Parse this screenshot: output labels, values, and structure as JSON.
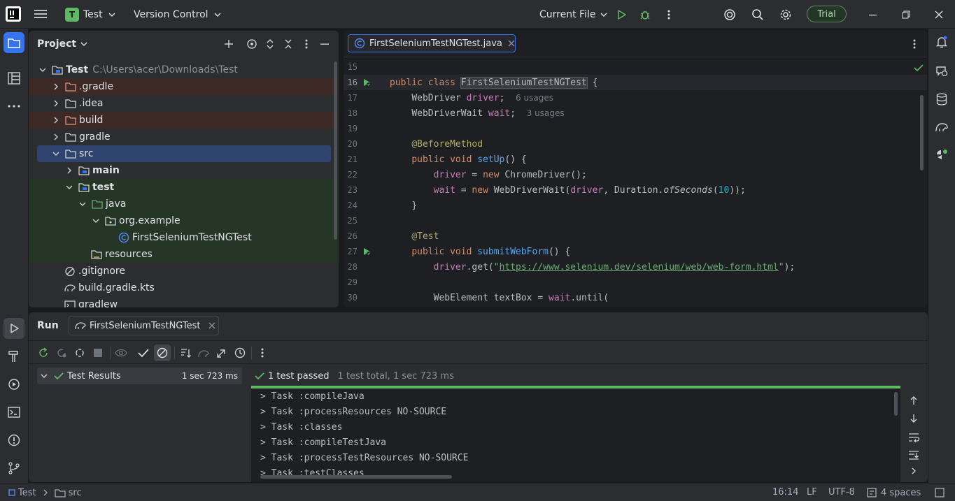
{
  "titlebar": {
    "project_badge": "T",
    "project_name": "Test",
    "vcs_label": "Version Control",
    "run_config": "Current File",
    "trial_label": "Trial"
  },
  "project_panel": {
    "title": "Project",
    "tree": [
      {
        "label": "Test",
        "path": "C:\\Users\\acer\\Downloads\\Test"
      },
      {
        "label": ".gradle"
      },
      {
        "label": ".idea"
      },
      {
        "label": "build"
      },
      {
        "label": "gradle"
      },
      {
        "label": "src"
      },
      {
        "label": "main"
      },
      {
        "label": "test"
      },
      {
        "label": "java"
      },
      {
        "label": "org.example"
      },
      {
        "label": "FirstSeleniumTestNGTest"
      },
      {
        "label": "resources"
      },
      {
        "label": ".gitignore"
      },
      {
        "label": "build.gradle.kts"
      },
      {
        "label": "gradlew"
      }
    ]
  },
  "editor": {
    "tab_label": "FirstSeleniumTestNGTest.java",
    "lines": [
      {
        "n": "15"
      },
      {
        "n": "16",
        "t": [
          "public class ",
          "FirstSeleniumTestNGTest",
          " {"
        ]
      },
      {
        "n": "17",
        "t": [
          "WebDriver ",
          "driver",
          ";",
          "6 usages"
        ]
      },
      {
        "n": "18",
        "t": [
          "WebDriverWait ",
          "wait",
          ";",
          "3 usages"
        ]
      },
      {
        "n": "19"
      },
      {
        "n": "20",
        "t": [
          "@BeforeMethod"
        ]
      },
      {
        "n": "21",
        "t": [
          "public void ",
          "setUp",
          "() {"
        ]
      },
      {
        "n": "22",
        "t": [
          "driver",
          " = ",
          "new ",
          "ChromeDriver();"
        ]
      },
      {
        "n": "23",
        "t": [
          "wait",
          " = ",
          "new ",
          "WebDriverWait(",
          "driver",
          ", Duration.",
          "ofSeconds",
          "(",
          "10",
          "));"
        ]
      },
      {
        "n": "24",
        "t": [
          "}"
        ]
      },
      {
        "n": "25"
      },
      {
        "n": "26",
        "t": [
          "@Test"
        ]
      },
      {
        "n": "27",
        "t": [
          "public void ",
          "submitWebForm",
          "() {"
        ]
      },
      {
        "n": "28",
        "t": [
          "driver",
          ".get(",
          "\"",
          "https://www.selenium.dev/selenium/web/web-form.html",
          "\"",
          ");"
        ]
      },
      {
        "n": "29"
      },
      {
        "n": "30",
        "t": [
          "WebElement textBox = ",
          "wait",
          ".until("
        ]
      }
    ]
  },
  "run_panel": {
    "title": "Run",
    "tab_label": "FirstSeleniumTestNGTest",
    "results_label": "Test Results",
    "results_time": "1 sec 723 ms",
    "status_passed": "1 test passed",
    "status_summary": "1 test total, 1 sec 723 ms",
    "console": [
      "> Task :compileJava",
      "> Task :processResources NO-SOURCE",
      "> Task :classes",
      "> Task :compileTestJava",
      "> Task :processTestResources NO-SOURCE",
      "> Task :testClasses"
    ]
  },
  "statusbar": {
    "crumb_project": "Test",
    "crumb_folder": "src",
    "position": "16:14",
    "line_sep": "LF",
    "encoding": "UTF-8",
    "indent": "4 spaces"
  },
  "colors": {
    "accent": "#3574f0",
    "selection": "#2e436e",
    "run_green": "#5fb865",
    "trial_border": "#5a8a5b"
  }
}
